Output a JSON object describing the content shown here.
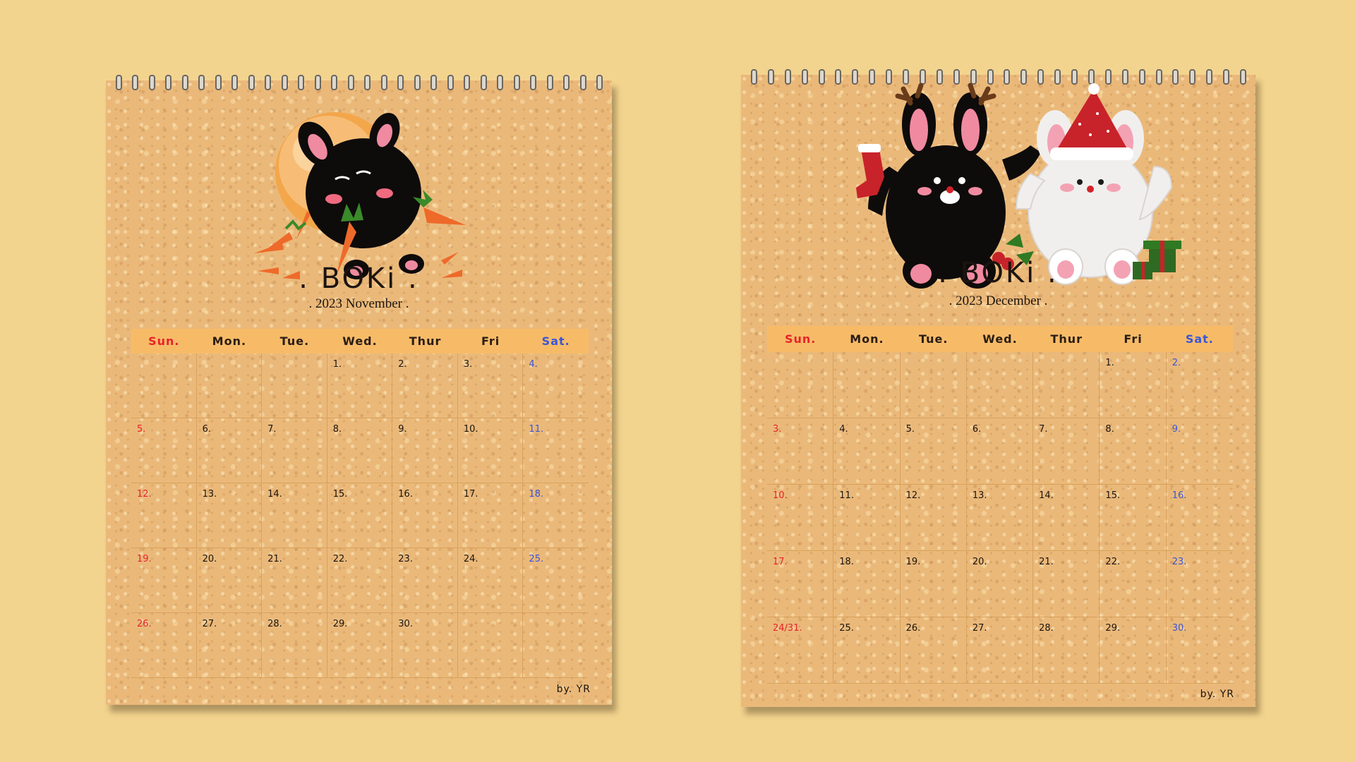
{
  "brand_left": ". BOKi .",
  "brand_right": ". BOKi .",
  "credit": "by. YR",
  "weekdays": [
    "Sun.",
    "Mon.",
    "Tue.",
    "Wed.",
    "Thur",
    "Fri",
    "Sat."
  ],
  "november": {
    "title": ". 2023 November .",
    "cells": [
      "",
      "",
      "",
      "1.",
      "2.",
      "3.",
      "4.",
      "5.",
      "6.",
      "7.",
      "8.",
      "9.",
      "10.",
      "11.",
      "12.",
      "13.",
      "14.",
      "15.",
      "16.",
      "17.",
      "18.",
      "19.",
      "20.",
      "21.",
      "22.",
      "23.",
      "24.",
      "25.",
      "26.",
      "27.",
      "28.",
      "29.",
      "30.",
      "",
      ""
    ]
  },
  "december": {
    "title": ". 2023 December .",
    "cells": [
      "",
      "",
      "",
      "",
      "",
      "1.",
      "2.",
      "3.",
      "4.",
      "5.",
      "6.",
      "7.",
      "8.",
      "9.",
      "10.",
      "11.",
      "12.",
      "13.",
      "14.",
      "15.",
      "16.",
      "17.",
      "18.",
      "19.",
      "20.",
      "21.",
      "22.",
      "23.",
      "24/31.",
      "25.",
      "26.",
      "27.",
      "28.",
      "29.",
      "30."
    ]
  },
  "colors": {
    "background": "#f3d48e",
    "paper": "#eab97a",
    "header": "#f7bb68",
    "sunday": "#e8232a",
    "saturday": "#3a56d6"
  },
  "icons": [
    "black-bunny-moon-carrots-illustration",
    "black-bunny-reindeer-and-white-bunny-santa-illustration"
  ]
}
